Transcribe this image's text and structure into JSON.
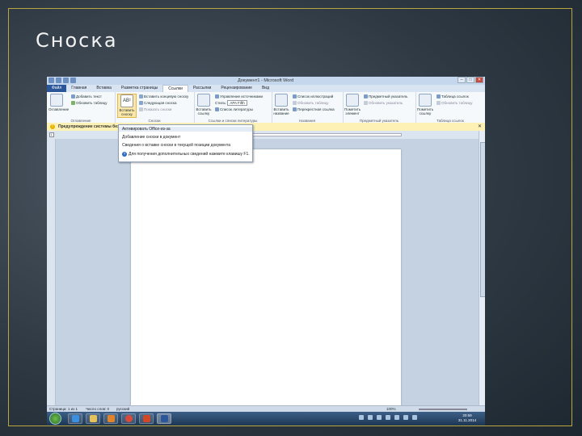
{
  "slide": {
    "title": "Сноска"
  },
  "window": {
    "title": "Документ1 - Microsoft Word",
    "controls": {
      "minimize": "–",
      "maximize": "□",
      "close": "✕"
    }
  },
  "tabs": [
    "Файл",
    "Главная",
    "Вставка",
    "Разметка страницы",
    "Ссылки",
    "Рассылки",
    "Рецензирование",
    "Вид"
  ],
  "active_tab": "Ссылки",
  "ribbon": {
    "toc": {
      "big": "Оглавление",
      "add_text": "Добавить текст",
      "update": "Обновить таблицу",
      "group": "Оглавление"
    },
    "footnotes": {
      "big": "Вставить сноску",
      "insert_endnote": "Вставить концевую сноску",
      "next_footnote": "Следующая сноска",
      "show_notes": "Показать сноски",
      "group": "Сноски"
    },
    "citations": {
      "big": "Вставить ссылку",
      "manage": "Управление источниками",
      "style_label": "Стиль:",
      "style_value": "APA Fifth",
      "bibliography": "Список литературы",
      "group": "Ссылки и списки литературы"
    },
    "captions": {
      "big": "Вставить название",
      "insert_table": "Список иллюстраций",
      "update": "Обновить таблицу",
      "cross_ref": "Перекрестная ссылка",
      "group": "Названия"
    },
    "index": {
      "big": "Пометить элемент",
      "insert": "Предметный указатель",
      "update": "Обновить указатель",
      "group": "Предметный указатель"
    },
    "authorities": {
      "big": "Пометить ссылку",
      "insert": "Таблица ссылок",
      "update": "Обновить таблицу",
      "group": "Таблица ссылок"
    }
  },
  "message_bar": {
    "text": "Предупреждение системы безопасности",
    "close": "✕"
  },
  "dropdown": {
    "items": [
      "Активировать  Office-из-за",
      "Добавление сноски в документ",
      "Сведения о вставке сноски в текущей позиции документа",
      "Для получения дополнительных сведений нажмите клавишу F1."
    ]
  },
  "ruler": {
    "tab_selector": "L"
  },
  "status_bar": {
    "page": "Страница: 1 из 1",
    "words": "Число слов: 0",
    "language": "русский",
    "zoom": "100%"
  },
  "taskbar": {
    "apps": [
      "ie-icon",
      "folder-icon",
      "media-player-icon",
      "chrome-icon",
      "powerpoint-icon",
      "word-icon"
    ],
    "clock_time": "20:59",
    "clock_date": "31.11.2014"
  },
  "colors": {
    "accent": "#2b579a",
    "frame": "#b9a640",
    "message": "#fdf1b5"
  }
}
